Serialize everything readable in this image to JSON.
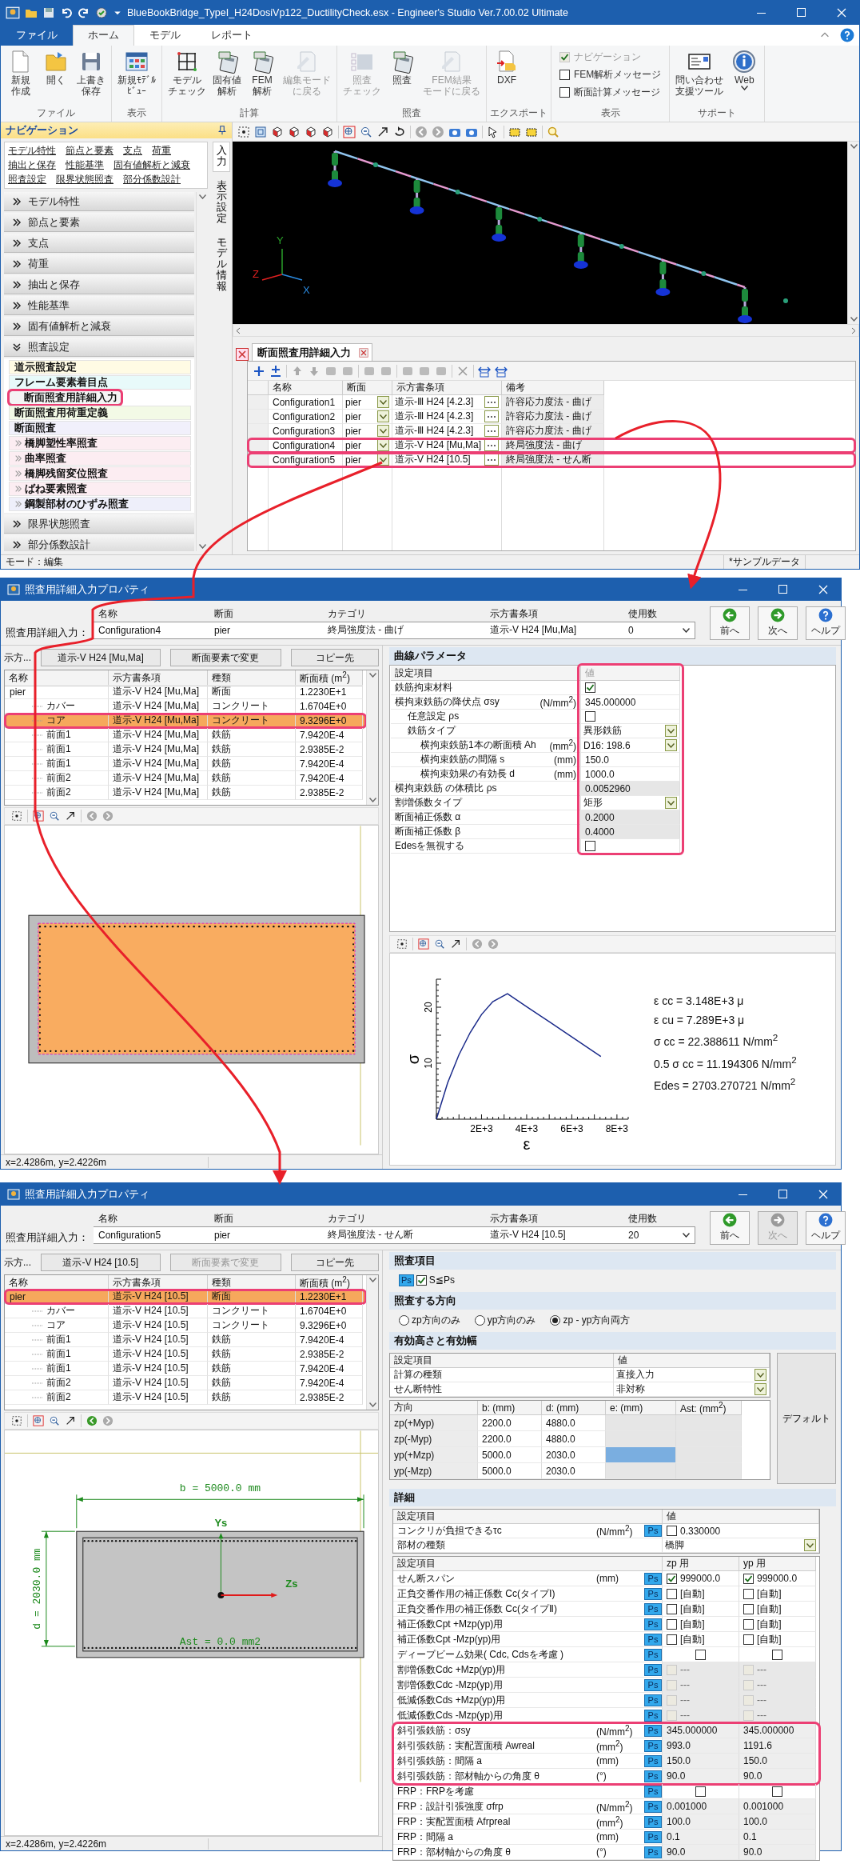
{
  "app": {
    "model_view": {
      "axis_labels": [
        "Y",
        "Z",
        "X"
      ]
    },
    "title": "BlueBookBridge_TypeI_H24DosiVp122_DuctilityCheck.esx - Engineer's Studio Ver.7.00.02 Ultimate",
    "menu_tabs": [
      {
        "label": "ファイル",
        "kind": "file",
        "selected": false
      },
      {
        "label": "ホーム",
        "kind": "tab",
        "selected": true
      },
      {
        "label": "モデル",
        "kind": "tab",
        "selected": false
      },
      {
        "label": "レポート",
        "kind": "tab",
        "selected": false
      }
    ],
    "ribbon": [
      {
        "label": "ファイル",
        "kind": "buttons",
        "buttons": [
          {
            "kind": "new",
            "lines": [
              "新規",
              "作成"
            ],
            "disabled": false
          },
          {
            "kind": "open",
            "lines": [
              "開く"
            ],
            "disabled": false
          },
          {
            "kind": "save",
            "lines": [
              "上書き",
              "保存"
            ],
            "disabled": false
          }
        ]
      },
      {
        "label": "表示",
        "kind": "buttons",
        "buttons": [
          {
            "kind": "view",
            "lines": [
              "新規ﾓﾃﾞﾙ",
              "ﾋﾞｭｰ"
            ],
            "disabled": false
          }
        ]
      },
      {
        "label": "計算",
        "kind": "buttons",
        "buttons": [
          {
            "kind": "check",
            "lines": [
              "モデル",
              "チェック"
            ],
            "disabled": false
          },
          {
            "kind": "calc",
            "lines": [
              "固有値",
              "解析"
            ],
            "disabled": false
          },
          {
            "kind": "calc",
            "lines": [
              "FEM",
              "解析"
            ],
            "disabled": false
          },
          {
            "kind": "edit",
            "lines": [
              "編集モード",
              "に戻る"
            ],
            "disabled": true
          }
        ]
      },
      {
        "label": "照査",
        "kind": "buttons",
        "buttons": [
          {
            "kind": "list",
            "lines": [
              "照査",
              "チェック"
            ],
            "disabled": true
          },
          {
            "kind": "calc",
            "lines": [
              "照査"
            ],
            "disabled": false
          },
          {
            "kind": "edit",
            "lines": [
              "FEM結果",
              "モードに戻る"
            ],
            "disabled": true
          }
        ]
      },
      {
        "label": "エクスポート",
        "kind": "buttons",
        "buttons": [
          {
            "kind": "dxf",
            "lines": [
              "DXF"
            ],
            "disabled": false
          }
        ]
      },
      {
        "label": "表示",
        "kind": "checks",
        "checks": [
          {
            "label": "ナビゲーション",
            "checked": true,
            "disabled": true
          },
          {
            "label": "FEM解析メッセージ",
            "checked": false,
            "disabled": false
          },
          {
            "label": "断面計算メッセージ",
            "checked": false,
            "disabled": false
          }
        ]
      },
      {
        "label": "サポート",
        "kind": "buttons",
        "buttons": [
          {
            "kind": "card",
            "lines": [
              "問い合わせ",
              "支援ツール"
            ],
            "disabled": false
          },
          {
            "kind": "info",
            "lines": [
              "Web"
            ],
            "disabled": false,
            "dropdown": true
          }
        ]
      }
    ],
    "navigation": {
      "title": "ナビゲーション",
      "links": [
        [
          "モデル特性",
          "節点と要素",
          "支点",
          "荷重"
        ],
        [
          "抽出と保存",
          "性能基準",
          "固有値解析と減衰"
        ],
        [
          "照査設定",
          "限界状態照査",
          "部分係数設計"
        ]
      ],
      "sections": [
        {
          "label": "モデル特性",
          "expanded": false
        },
        {
          "label": "節点と要素",
          "expanded": false
        },
        {
          "label": "支点",
          "expanded": false
        },
        {
          "label": "荷重",
          "expanded": false
        },
        {
          "label": "抽出と保存",
          "expanded": false
        },
        {
          "label": "性能基準",
          "expanded": false
        },
        {
          "label": "固有値解析と減衰",
          "expanded": false
        },
        {
          "label": "照査設定",
          "expanded": true,
          "items": [
            {
              "label": "道示照査設定",
              "kind": "item",
              "color": "#fffbe4",
              "selected": false,
              "marked": false
            },
            {
              "label": "フレーム要素着目点",
              "kind": "item",
              "color": "#e8fafa",
              "selected": false,
              "marked": false
            },
            {
              "label": "断面照査用詳細入力",
              "kind": "item",
              "color": "#f4f4f4",
              "selected": true,
              "marked": true
            },
            {
              "label": "断面照査用荷重定義",
              "kind": "item",
              "color": "#f3fae6",
              "selected": false,
              "marked": false
            },
            {
              "label": "断面照査",
              "kind": "item",
              "color": "#f1f0fb",
              "selected": false,
              "marked": false
            },
            {
              "label": "橋脚塑性率照査",
              "kind": "group",
              "color": "#fcedf2",
              "selected": false,
              "marked": false
            },
            {
              "label": "曲率照査",
              "kind": "group",
              "color": "#fcedf2",
              "selected": false,
              "marked": false
            },
            {
              "label": "橋脚残留変位照査",
              "kind": "group",
              "color": "#fcedf2",
              "selected": false,
              "marked": false
            },
            {
              "label": "ばね要素照査",
              "kind": "group",
              "color": "#fcedf2",
              "selected": false,
              "marked": false
            },
            {
              "label": "鋼製部材のひずみ照査",
              "kind": "group",
              "color": "#eeeffa",
              "selected": false,
              "marked": false
            }
          ]
        },
        {
          "label": "限界状態照査",
          "expanded": false
        },
        {
          "label": "部分係数設計",
          "expanded": false
        }
      ],
      "side_tabs": [
        {
          "label": "入力",
          "selected": true
        },
        {
          "label": "表示設定",
          "selected": false
        },
        {
          "label": "モデル情報",
          "selected": false
        }
      ]
    },
    "detail_panel": {
      "tab": "断面照査用詳細入力",
      "columns": [
        "名称",
        "断面",
        "示方書条項",
        "備考"
      ],
      "rows": [
        {
          "name": "Configuration1",
          "section": "pier",
          "clause": "道示-Ⅲ H24 [4.2.3]",
          "note": "許容応力度法 - 曲げ",
          "marked": false
        },
        {
          "name": "Configuration2",
          "section": "pier",
          "clause": "道示-Ⅲ H24 [4.2.3]",
          "note": "許容応力度法 - 曲げ",
          "marked": false
        },
        {
          "name": "Configuration3",
          "section": "pier",
          "clause": "道示-Ⅲ H24 [4.2.3]",
          "note": "許容応力度法 - 曲げ",
          "marked": false
        },
        {
          "name": "Configuration4",
          "section": "pier",
          "clause": "道示-V H24 [Mu,Ma]",
          "note": "終局強度法 - 曲げ",
          "marked": true
        },
        {
          "name": "Configuration5",
          "section": "pier",
          "clause": "道示-V H24 [10.5]",
          "note": "終局強度法 - せん断",
          "marked": true
        }
      ]
    },
    "status": {
      "mode": "モード：編集",
      "file": "*サンプルデータ"
    }
  },
  "config_windows": [
    {
      "title": "照査用詳細入力プロパティ",
      "header_label": "照査用詳細入力：",
      "header_columns": [
        "名称",
        "断面",
        "カテゴリ",
        "示方書条項",
        "使用数"
      ],
      "header_values": [
        "Configuration4",
        "pier",
        "終局強度法 - 曲げ",
        "道示-V H24 [Mu,Ma]",
        "0"
      ],
      "nav_buttons": [
        {
          "kind": "prev",
          "label": "前へ",
          "disabled": false
        },
        {
          "kind": "next",
          "label": "次へ",
          "disabled": false
        },
        {
          "kind": "help",
          "label": "ヘルプ",
          "disabled": false
        }
      ],
      "clause_label": "示方...",
      "clause_buttons": [
        {
          "label": "道示-V H24 [Mu,Ma]",
          "disabled": false
        },
        {
          "label": "断面要素で変更",
          "disabled": false
        },
        {
          "label": "コピー先",
          "disabled": false
        }
      ],
      "element_columns": [
        "名称",
        "示方書条項",
        "種類",
        "断面積 (m$^{2}$)"
      ],
      "elements": [
        {
          "name": "pier",
          "clause": "道示-V H24 [Mu,Ma]",
          "type": "断面",
          "area": "1.2230E+1",
          "selected": false,
          "marked": false,
          "children": [
            {
              "name": "カバー",
              "clause": "道示-V H24 [Mu,Ma]",
              "type": "コンクリート",
              "area": "1.6704E+0",
              "selected": false,
              "marked": false
            },
            {
              "name": "コア",
              "clause": "道示-V H24 [Mu,Ma]",
              "type": "コンクリート",
              "area": "9.3296E+0",
              "selected": true,
              "marked": true
            },
            {
              "name": "前面1",
              "clause": "道示-V H24 [Mu,Ma]",
              "type": "鉄筋",
              "area": "7.9420E-4",
              "selected": false,
              "marked": false
            },
            {
              "name": "前面1",
              "clause": "道示-V H24 [Mu,Ma]",
              "type": "鉄筋",
              "area": "2.9385E-2",
              "selected": false,
              "marked": false
            },
            {
              "name": "前面1",
              "clause": "道示-V H24 [Mu,Ma]",
              "type": "鉄筋",
              "area": "7.9420E-4",
              "selected": false,
              "marked": false
            },
            {
              "name": "前面2",
              "clause": "道示-V H24 [Mu,Ma]",
              "type": "鉄筋",
              "area": "7.9420E-4",
              "selected": false,
              "marked": false
            },
            {
              "name": "前面2",
              "clause": "道示-V H24 [Mu,Ma]",
              "type": "鉄筋",
              "area": "2.9385E-2",
              "selected": false,
              "marked": false
            }
          ]
        }
      ],
      "drawing": {
        "kind": "filled"
      },
      "coords": "x=2.4286m, y=2.4226m",
      "right": {
        "kind": "curve",
        "section_title": "曲線パラメータ",
        "columns": [
          "設定項目",
          "値"
        ],
        "values_marked": true,
        "params": [
          {
            "label": "鉄筋拘束材料",
            "kind": "check",
            "checked": true
          },
          {
            "label": "横拘束鉄筋の降伏点 σsy",
            "unit": "(N/mm$^{2}$)",
            "kind": "text",
            "value": "345.000000",
            "children": [
              {
                "label": "任意設定 ρs",
                "kind": "check",
                "checked": false
              },
              {
                "label": "鉄筋タイプ",
                "kind": "select",
                "value": "異形鉄筋",
                "children": [
                  {
                    "label": "横拘束鉄筋1本の断面積 Ah",
                    "unit": "(mm$^{2}$)",
                    "kind": "select",
                    "value": "D16: 198.6"
                  },
                  {
                    "label": "横拘束鉄筋の間隔 s",
                    "unit": "(mm)",
                    "kind": "text",
                    "value": "150.0"
                  },
                  {
                    "label": "横拘束効果の有効長 d",
                    "unit": "(mm)",
                    "kind": "text",
                    "value": "1000.0"
                  }
                ]
              }
            ]
          },
          {
            "label": "横拘束鉄筋 の体積比 ρs",
            "kind": "readonly",
            "value": "0.0052960"
          },
          {
            "label": "割増係数タイプ",
            "kind": "select",
            "value": "矩形"
          },
          {
            "label": "断面補正係数 α",
            "kind": "readonly",
            "value": "0.2000"
          },
          {
            "label": "断面補正係数 β",
            "kind": "readonly",
            "value": "0.4000"
          },
          {
            "label": "Edesを無視する",
            "kind": "check",
            "checked": false
          }
        ],
        "chart_data": {
          "type": "line",
          "xlabel": "ε",
          "ylabel": "σ",
          "x": [
            0,
            500,
            1000,
            1500,
            2000,
            2500,
            3148,
            4000,
            5000,
            6000,
            7289
          ],
          "series": [
            {
              "color": "#1a2a8a",
              "values": [
                0,
                6.5,
                11.5,
                15.5,
                18.7,
                21.0,
                22.4,
                20.1,
                17.4,
                14.7,
                11.2
              ]
            }
          ],
          "xlim": [
            0,
            8500
          ],
          "ylim": [
            0,
            25
          ],
          "xticks": [
            {
              "value": 2000,
              "label": "2E+3"
            },
            {
              "value": 4000,
              "label": "4E+3"
            },
            {
              "value": 6000,
              "label": "6E+3"
            },
            {
              "value": 8000,
              "label": "8E+3"
            }
          ],
          "yticks": [
            10,
            20
          ]
        },
        "results": [
          "ε cc = 3.148E+3 μ",
          "ε cu = 7.289E+3 μ",
          "σ cc = 22.388611 N/mm$^{2}$",
          "0.5 σ cc = 11.194306 N/mm$^{2}$",
          "Edes = 2703.270721 N/mm$^{2}$"
        ]
      }
    },
    {
      "title": "照査用詳細入力プロパティ",
      "header_label": "照査用詳細入力：",
      "header_columns": [
        "名称",
        "断面",
        "カテゴリ",
        "示方書条項",
        "使用数"
      ],
      "header_values": [
        "Configuration5",
        "pier",
        "終局強度法 - せん断",
        "道示-V H24 [10.5]",
        "20"
      ],
      "nav_buttons": [
        {
          "kind": "prev",
          "label": "前へ",
          "disabled": false
        },
        {
          "kind": "next",
          "label": "次へ",
          "disabled": true
        },
        {
          "kind": "help",
          "label": "ヘルプ",
          "disabled": false
        }
      ],
      "clause_label": "示方...",
      "clause_buttons": [
        {
          "label": "道示-V H24 [10.5]",
          "disabled": false
        },
        {
          "label": "断面要素で変更",
          "disabled": true
        },
        {
          "label": "コピー先",
          "disabled": false
        }
      ],
      "element_columns": [
        "名称",
        "示方書条項",
        "種類",
        "断面積 (m$^{2}$)"
      ],
      "elements": [
        {
          "name": "pier",
          "clause": "道示-V H24 [10.5]",
          "type": "断面",
          "area": "1.2230E+1",
          "selected": true,
          "marked": true,
          "children": [
            {
              "name": "カバー",
              "clause": "道示-V H24 [10.5]",
              "type": "コンクリート",
              "area": "1.6704E+0",
              "selected": false,
              "marked": false
            },
            {
              "name": "コア",
              "clause": "道示-V H24 [10.5]",
              "type": "コンクリート",
              "area": "9.3296E+0",
              "selected": false,
              "marked": false
            },
            {
              "name": "前面1",
              "clause": "道示-V H24 [10.5]",
              "type": "鉄筋",
              "area": "7.9420E-4",
              "selected": false,
              "marked": false
            },
            {
              "name": "前面1",
              "clause": "道示-V H24 [10.5]",
              "type": "鉄筋",
              "area": "2.9385E-2",
              "selected": false,
              "marked": false
            },
            {
              "name": "前面1",
              "clause": "道示-V H24 [10.5]",
              "type": "鉄筋",
              "area": "7.9420E-4",
              "selected": false,
              "marked": false
            },
            {
              "name": "前面2",
              "clause": "道示-V H24 [10.5]",
              "type": "鉄筋",
              "area": "7.9420E-4",
              "selected": false,
              "marked": false
            },
            {
              "name": "前面2",
              "clause": "道示-V H24 [10.5]",
              "type": "鉄筋",
              "area": "2.9385E-2",
              "selected": false,
              "marked": false
            }
          ]
        }
      ],
      "drawing": {
        "kind": "dimensioned",
        "b_label": "b = 5000.0 mm",
        "d_label": "d = 2030.0 mm",
        "y_axis": "Ys",
        "z_axis": "Zs",
        "ast_label": "Ast = 0.0 mm2"
      },
      "coords": "x=2.4286m, y=2.4226m",
      "right": {
        "kind": "shear",
        "check_title": "照査項目",
        "check": {
          "badge": "Ps",
          "label": "S≦Ps",
          "checked": true
        },
        "direction_title": "照査する方向",
        "directions": [
          {
            "label": "zp方向のみ",
            "selected": false
          },
          {
            "label": "yp方向のみ",
            "selected": false
          },
          {
            "label": "zp - yp方向両方",
            "selected": true
          }
        ],
        "effective_title": "有効高さと有効幅",
        "effective_columns": [
          "設定項目",
          "値"
        ],
        "effective_rows": [
          {
            "label": "計算の種類",
            "value": "直接入力"
          },
          {
            "label": "せん断特性",
            "value": "非対称"
          }
        ],
        "dir_columns": [
          "方向",
          "b: (mm)",
          "d: (mm)",
          "e: (mm)",
          "Ast: (mm$^{2}$)"
        ],
        "dir_rows": [
          {
            "label": "zp(+Myp)",
            "b": "2200.0",
            "d": "4880.0",
            "e_selected": false
          },
          {
            "label": "zp(-Myp)",
            "b": "2200.0",
            "d": "4880.0",
            "e_selected": false
          },
          {
            "label": "yp(+Mzp)",
            "b": "5000.0",
            "d": "2030.0",
            "e_selected": true
          },
          {
            "label": "yp(-Mzp)",
            "b": "5000.0",
            "d": "2030.0",
            "e_selected": false
          }
        ],
        "default_button": "デフォルト",
        "detail_title": "詳細",
        "detail_columns": [
          "設定項目",
          "値"
        ],
        "detail_rows": [
          {
            "label": "コンクリが負担できるτc",
            "unit": "(N/mm$^{2}$)",
            "badge": "Ps",
            "kind": "check_value",
            "checked": false,
            "value": "0.330000"
          },
          {
            "label": "部材の種類",
            "kind": "select",
            "value": "橋脚"
          }
        ],
        "span_columns": [
          "設定項目",
          "zp 用",
          "yp 用"
        ],
        "span_rows": [
          {
            "label": "せん断スパン",
            "unit": "(mm)",
            "badge": "Ps",
            "kind": "check_value",
            "marked": false,
            "zp": {
              "checked": true,
              "value": "999000.0"
            },
            "yp": {
              "checked": true,
              "value": "999000.0"
            }
          },
          {
            "label": "正負交番作用の補正係数 Cc(タイプⅠ)",
            "badge": "Ps",
            "kind": "check_value",
            "marked": false,
            "zp": {
              "checked": false,
              "value": "[自動]"
            },
            "yp": {
              "checked": false,
              "value": "[自動]"
            }
          },
          {
            "label": "正負交番作用の補正係数 Cc(タイプⅡ)",
            "badge": "Ps",
            "kind": "check_value",
            "marked": false,
            "zp": {
              "checked": false,
              "value": "[自動]"
            },
            "yp": {
              "checked": false,
              "value": "[自動]"
            }
          },
          {
            "label": "補正係数Cpt +Mzp(yp)用",
            "badge": "Ps",
            "kind": "check_value",
            "marked": false,
            "zp": {
              "checked": false,
              "value": "[自動]"
            },
            "yp": {
              "checked": false,
              "value": "[自動]"
            }
          },
          {
            "label": "補正係数Cpt -Mzp(yp)用",
            "badge": "Ps",
            "kind": "check_value",
            "marked": false,
            "zp": {
              "checked": false,
              "value": "[自動]"
            },
            "yp": {
              "checked": false,
              "value": "[自動]"
            }
          },
          {
            "label": "ディープビーム効果( Cdc, Cdsを考慮 )",
            "badge": "Ps",
            "kind": "check",
            "marked": false,
            "zp": {
              "checked": false
            },
            "yp": {
              "checked": false
            }
          },
          {
            "label": "割増係数Cdc +Mzp(yp)用",
            "badge": "Ps",
            "kind": "disabled",
            "marked": false,
            "zp": {
              "checked": false,
              "value": "---"
            },
            "yp": {
              "checked": false,
              "value": "---"
            }
          },
          {
            "label": "割増係数Cdc -Mzp(yp)用",
            "badge": "Ps",
            "kind": "disabled",
            "marked": false,
            "zp": {
              "checked": false,
              "value": "---"
            },
            "yp": {
              "checked": false,
              "value": "---"
            }
          },
          {
            "label": "低減係数Cds +Mzp(yp)用",
            "badge": "Ps",
            "kind": "disabled",
            "marked": false,
            "zp": {
              "checked": false,
              "value": "---"
            },
            "yp": {
              "checked": false,
              "value": "---"
            }
          },
          {
            "label": "低減係数Cds -Mzp(yp)用",
            "badge": "Ps",
            "kind": "disabled",
            "marked": false,
            "zp": {
              "checked": false,
              "value": "---"
            },
            "yp": {
              "checked": false,
              "value": "---"
            }
          },
          {
            "label": "斜引張鉄筋：σsy",
            "unit": "(N/mm$^{2}$)",
            "badge": "Ps",
            "kind": "value",
            "marked": true,
            "zp": {
              "value": "345.000000"
            },
            "yp": {
              "value": "345.000000"
            }
          },
          {
            "label": "斜引張鉄筋：実配置面積 Awreal",
            "unit": "(mm$^{2}$)",
            "badge": "Ps",
            "kind": "value",
            "marked": true,
            "zp": {
              "value": "993.0"
            },
            "yp": {
              "value": "1191.6"
            }
          },
          {
            "label": "斜引張鉄筋：間隔 a",
            "unit": "(mm)",
            "badge": "Ps",
            "kind": "value",
            "marked": true,
            "zp": {
              "value": "150.0"
            },
            "yp": {
              "value": "150.0"
            }
          },
          {
            "label": "斜引張鉄筋：部材軸からの角度 θ",
            "unit": "(°)",
            "badge": "Ps",
            "kind": "value",
            "marked": true,
            "zp": {
              "value": "90.0"
            },
            "yp": {
              "value": "90.0"
            }
          },
          {
            "label": "FRP：FRPを考慮",
            "badge": "Ps",
            "kind": "check",
            "marked": false,
            "zp": {
              "checked": false
            },
            "yp": {
              "checked": false
            }
          },
          {
            "label": "FRP：設計引張強度 σfrp",
            "unit": "(N/mm$^{2}$)",
            "badge": "Ps",
            "kind": "value",
            "marked": false,
            "zp": {
              "value": "0.001000"
            },
            "yp": {
              "value": "0.001000"
            }
          },
          {
            "label": "FRP：実配置面積 Afrpreal",
            "unit": "(mm$^{2}$)",
            "badge": "Ps",
            "kind": "value",
            "marked": false,
            "zp": {
              "value": "100.0"
            },
            "yp": {
              "value": "100.0"
            }
          },
          {
            "label": "FRP：間隔 a",
            "unit": "(mm)",
            "badge": "Ps",
            "kind": "value",
            "marked": false,
            "zp": {
              "value": "0.1"
            },
            "yp": {
              "value": "0.1"
            }
          },
          {
            "label": "FRP：部材軸からの角度 θ",
            "unit": "(°)",
            "badge": "Ps",
            "kind": "value",
            "marked": false,
            "zp": {
              "value": "90.0"
            },
            "yp": {
              "value": "90.0"
            }
          }
        ]
      }
    }
  ]
}
